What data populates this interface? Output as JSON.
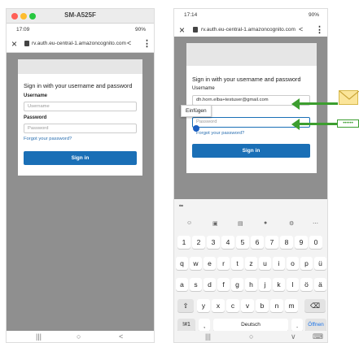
{
  "left_phone": {
    "window_title": "SM-A525F",
    "status_time": "17:09",
    "status_right": "90%",
    "url": "rv.auth.eu-central-1.amazoncognito.com",
    "heading": "Sign in with your username and password",
    "username_label": "Username",
    "username_placeholder": "Username",
    "password_label": "Password",
    "password_placeholder": "Password",
    "forgot_link": "Forgot your password?",
    "signin_button": "Sign in",
    "nav": [
      "|||",
      "○",
      "<"
    ]
  },
  "right_phone": {
    "status_time": "17:14",
    "status_right": "90%",
    "url": "rv.auth.eu-central-1.amazoncognito.com",
    "heading": "Sign in with your username and password",
    "username_label": "Username",
    "username_value": "dh.horn.elba+testuser@gmail.com",
    "password_placeholder": "Password",
    "paste_popup": "Einfügen",
    "forgot_link": "Forgot your password?",
    "signin_button": "Sign in",
    "keyboard": {
      "number_row": [
        "1",
        "2",
        "3",
        "4",
        "5",
        "6",
        "7",
        "8",
        "9",
        "0"
      ],
      "row1": [
        "q",
        "w",
        "e",
        "r",
        "t",
        "z",
        "u",
        "i",
        "o",
        "p",
        "ü"
      ],
      "row2": [
        "a",
        "s",
        "d",
        "f",
        "g",
        "h",
        "j",
        "k",
        "l",
        "ö",
        "ä"
      ],
      "row3": [
        "y",
        "x",
        "c",
        "v",
        "b",
        "n",
        "m"
      ],
      "sym_key": "!#1",
      "comma_key": ",",
      "space_key": "Deutsch",
      "period_key": ".",
      "enter_key": "Öffnen"
    },
    "nav": [
      "|||",
      "○",
      "∨",
      "⌨"
    ]
  },
  "annotations": {
    "password_mask": "••••••",
    "accent_green": "#3c9e2f"
  }
}
